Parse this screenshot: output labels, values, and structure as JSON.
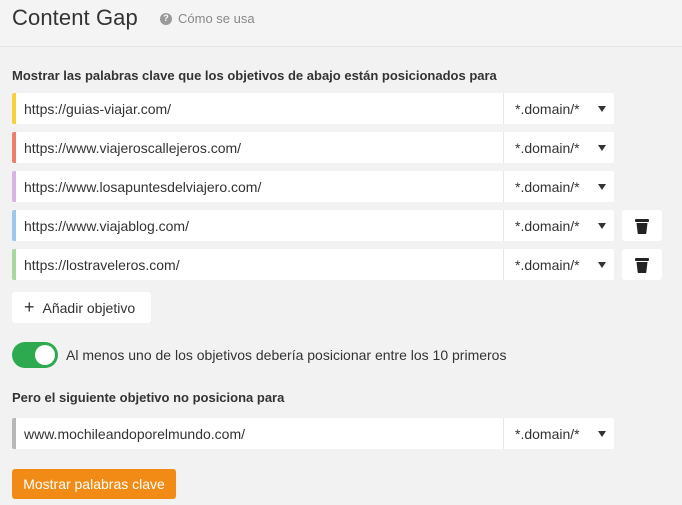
{
  "header": {
    "title": "Content Gap",
    "help_label": "Cómo se usa"
  },
  "targets_section": {
    "label": "Mostrar las palabras clave que los objetivos de abajo están posicionados para",
    "targets": [
      {
        "url": "https://guias-viajar.com/",
        "mode": "*.domain/*",
        "color": "#f7d13c",
        "removable": false
      },
      {
        "url": "https://www.viajeroscallejeros.com/",
        "mode": "*.domain/*",
        "color": "#ee7f6b",
        "removable": false
      },
      {
        "url": "https://www.losapuntesdelviajero.com/",
        "mode": "*.domain/*",
        "color": "#d8b4e2",
        "removable": false
      },
      {
        "url": "https://www.viajablog.com/",
        "mode": "*.domain/*",
        "color": "#9cc9ea",
        "removable": true
      },
      {
        "url": "https://lostraveleros.com/",
        "mode": "*.domain/*",
        "color": "#a8d8a0",
        "removable": true
      }
    ],
    "add_label": "Añadir objetivo"
  },
  "toggle": {
    "on": true,
    "label": "Al menos uno de los objetivos debería posicionar entre los 10 primeros"
  },
  "exclude_section": {
    "label": "Pero el siguiente objetivo no posiciona para",
    "target": {
      "url": "www.mochileandoporelmundo.com/",
      "mode": "*.domain/*",
      "color": "#b8b8b8"
    }
  },
  "submit_label": "Mostrar palabras clave",
  "colors": {
    "accent": "#f28a16",
    "toggle_on": "#2daa4f"
  }
}
